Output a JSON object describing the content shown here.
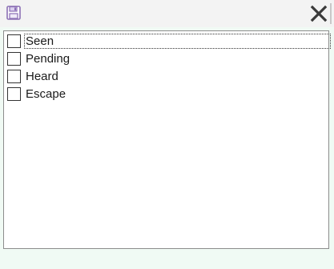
{
  "toolbar": {
    "save_icon": "floppy-disk-icon",
    "close_icon": "close-x-icon"
  },
  "colors": {
    "toolbar_bg": "#f3f3f3",
    "page_bg": "#f0faf4",
    "save_icon": "#8b6fb5",
    "list_border": "#8c8c8c"
  },
  "checklist": {
    "items": [
      {
        "label": "Seen",
        "checked": false,
        "focused": true
      },
      {
        "label": "Pending",
        "checked": false,
        "focused": false
      },
      {
        "label": "Heard",
        "checked": false,
        "focused": false
      },
      {
        "label": "Escape",
        "checked": false,
        "focused": false
      }
    ]
  }
}
